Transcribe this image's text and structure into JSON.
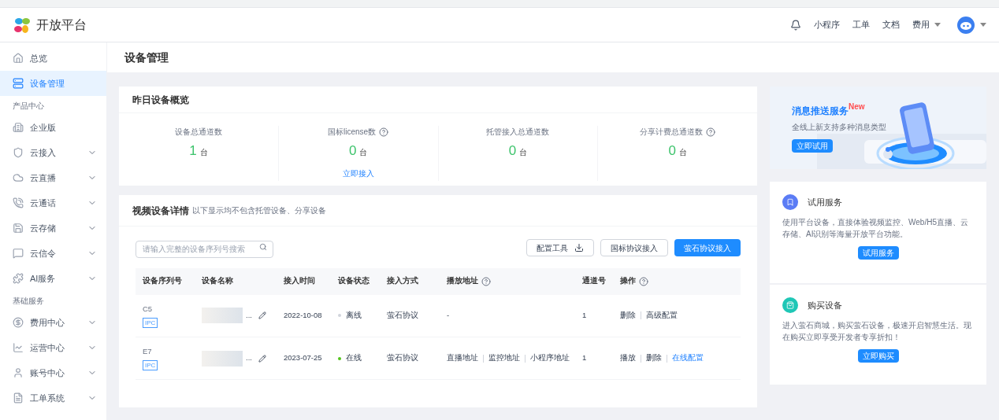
{
  "header": {
    "brand": "开放平台",
    "nav": [
      {
        "label": "小程序",
        "dropdown": false
      },
      {
        "label": "工单",
        "dropdown": false
      },
      {
        "label": "文档",
        "dropdown": false
      },
      {
        "label": "费用",
        "dropdown": true
      }
    ]
  },
  "sidebar": [
    {
      "kind": "item",
      "label": "总览",
      "selected": false,
      "expandable": false
    },
    {
      "kind": "item",
      "label": "设备管理",
      "selected": true,
      "expandable": false
    },
    {
      "kind": "section",
      "label": "产品中心"
    },
    {
      "kind": "item",
      "label": "企业版",
      "selected": false,
      "expandable": false
    },
    {
      "kind": "item",
      "label": "云接入",
      "selected": false,
      "expandable": true
    },
    {
      "kind": "item",
      "label": "云直播",
      "selected": false,
      "expandable": true
    },
    {
      "kind": "item",
      "label": "云通话",
      "selected": false,
      "expandable": true
    },
    {
      "kind": "item",
      "label": "云存储",
      "selected": false,
      "expandable": true
    },
    {
      "kind": "item",
      "label": "云信令",
      "selected": false,
      "expandable": true
    },
    {
      "kind": "item",
      "label": "AI服务",
      "selected": false,
      "expandable": true
    },
    {
      "kind": "section",
      "label": "基础服务"
    },
    {
      "kind": "item",
      "label": "费用中心",
      "selected": false,
      "expandable": true
    },
    {
      "kind": "item",
      "label": "运营中心",
      "selected": false,
      "expandable": true
    },
    {
      "kind": "item",
      "label": "账号中心",
      "selected": false,
      "expandable": true
    },
    {
      "kind": "item",
      "label": "工单系统",
      "selected": false,
      "expandable": true
    }
  ],
  "page_title": "设备管理",
  "overview": {
    "title": "昨日设备概览",
    "stats": [
      {
        "label": "设备总通道数",
        "help": false,
        "value": "1",
        "unit": "台"
      },
      {
        "label": "国标license数",
        "help": true,
        "value": "0",
        "unit": "台",
        "link": "立即接入"
      },
      {
        "label": "托管接入总通道数",
        "help": false,
        "value": "0",
        "unit": "台"
      },
      {
        "label": "分享计费总通道数",
        "help": true,
        "value": "0",
        "unit": "台"
      }
    ]
  },
  "devices": {
    "title": "视频设备详情",
    "note": "以下显示均不包含托管设备、分享设备",
    "search": {
      "placeholder": "请输入完整的设备序列号搜索"
    },
    "buttons": [
      {
        "label": "配置工具",
        "kind": "download"
      },
      {
        "label": "国标协议接入",
        "kind": "default"
      },
      {
        "label": "萤石协议接入",
        "kind": "primary"
      }
    ],
    "columns": [
      {
        "label": "设备序列号",
        "help": false
      },
      {
        "label": "设备名称",
        "help": false
      },
      {
        "label": "接入时间",
        "help": false
      },
      {
        "label": "设备状态",
        "help": false
      },
      {
        "label": "接入方式",
        "help": false
      },
      {
        "label": "播放地址",
        "help": true
      },
      {
        "label": "通道号",
        "help": false
      },
      {
        "label": "操作",
        "help": true
      }
    ],
    "rows": [
      {
        "serial": "C5",
        "tag": "IPC",
        "name": "...",
        "time": "2022-10-08",
        "status": "离线",
        "online": false,
        "method": "萤石协议",
        "play": [
          "-"
        ],
        "channel": "1",
        "actions": [
          {
            "label": "删除",
            "kind": "plain"
          },
          {
            "label": "高级配置",
            "kind": "plain"
          }
        ]
      },
      {
        "serial": "E7",
        "tag": "IPC",
        "name": "...",
        "time": "2023-07-25",
        "status": "在线",
        "online": true,
        "method": "萤石协议",
        "play": [
          "直播地址",
          "监控地址",
          "小程序地址"
        ],
        "channel": "1",
        "actions": [
          {
            "label": "播放",
            "kind": "plain"
          },
          {
            "label": "删除",
            "kind": "plain"
          },
          {
            "label": "在线配置",
            "kind": "link"
          }
        ]
      }
    ]
  },
  "promo": {
    "title": "消息推送服务",
    "badge": "New",
    "subtitle": "全线上新支持多种消息类型",
    "button": "立即试用",
    "kind": "picture"
  },
  "cards": [
    {
      "color": "#5b7cf5",
      "title": "试用服务",
      "text": "使用平台设备，直接体验视频监控、Web/H5直播、云存储、AI识别等海量开放平台功能。",
      "button": "试用服务"
    },
    {
      "color": "#1fc7b6",
      "title": "购买设备",
      "text": "进入萤石商城，购买萤石设备，极速开启智慧生活。现在购买立即享受开发者专享折扣！",
      "button": "立即购买"
    }
  ]
}
